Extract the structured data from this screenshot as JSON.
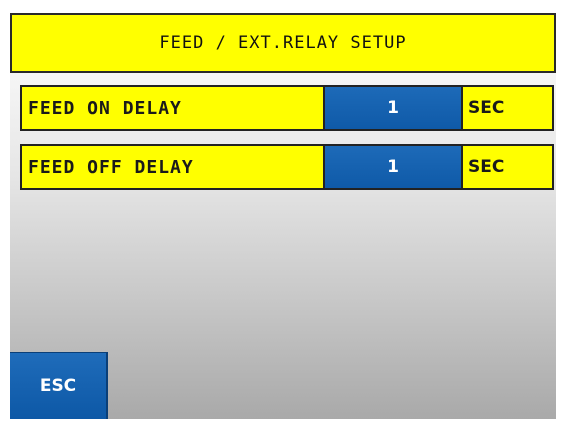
{
  "header": {
    "title": "FEED / EXT.RELAY SETUP"
  },
  "settings": [
    {
      "label": "FEED ON DELAY",
      "value": "1",
      "unit": "SEC"
    },
    {
      "label": "FEED OFF DELAY",
      "value": "1",
      "unit": "SEC"
    }
  ],
  "footer": {
    "esc_label": "ESC"
  },
  "colors": {
    "header_bg": "#ffff00",
    "label_bg": "#ffff00",
    "value_bg": "#1560ad",
    "button_bg": "#1560ad"
  }
}
